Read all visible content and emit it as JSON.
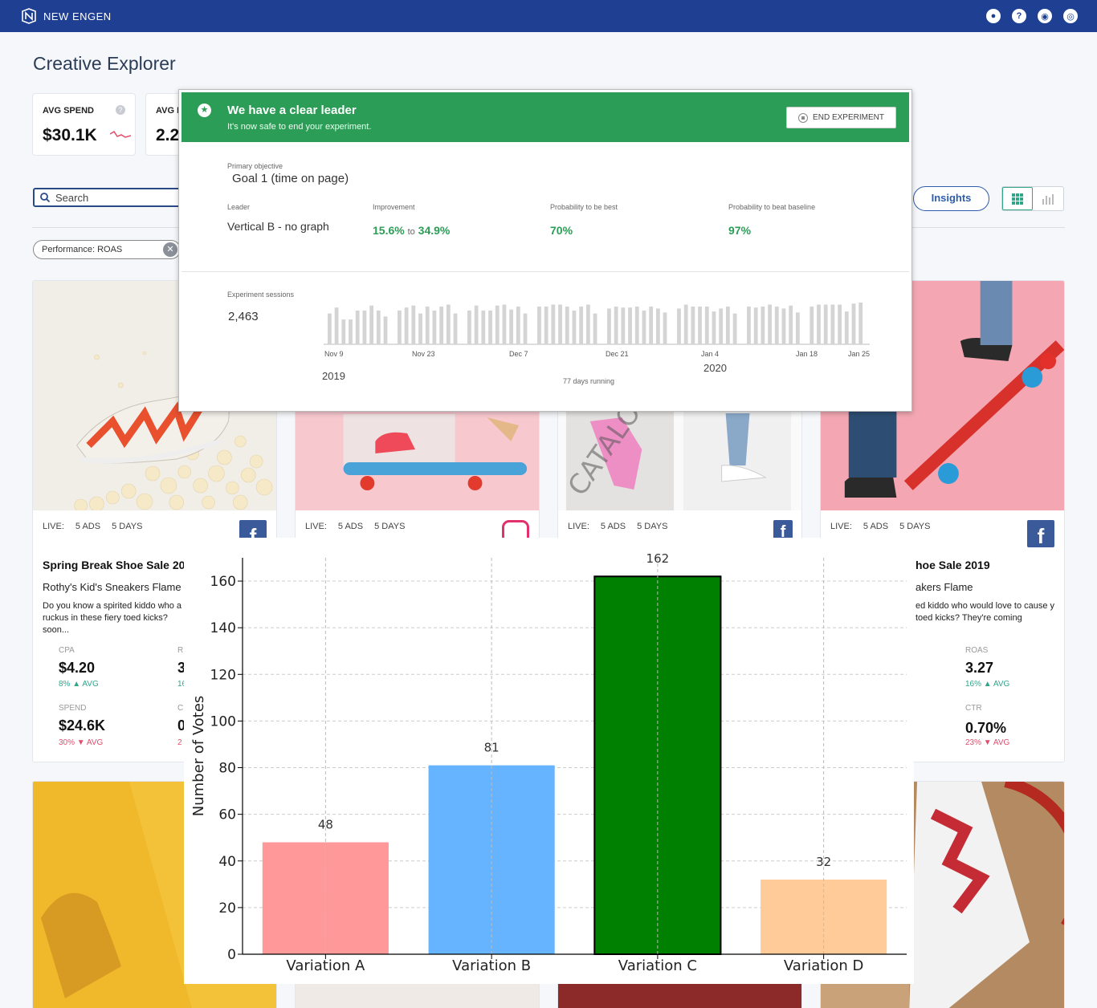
{
  "app": {
    "brand": "NEW ENGEN",
    "page_title": "Creative Explorer"
  },
  "nav_icons": [
    "bell-icon",
    "help-icon",
    "target-icon",
    "account-icon"
  ],
  "kpis": [
    {
      "label": "AVG SPEND",
      "value": "$30.1K"
    },
    {
      "label": "AVG R",
      "value": "2.2"
    }
  ],
  "toolbar": {
    "search_label": "Search",
    "filter_chip": "Performance: ROAS",
    "insights_label": "Insights"
  },
  "cards": [
    {
      "live": "LIVE:",
      "ads": "5 ADS",
      "days": "5 DAYS",
      "title": "Spring Break Shoe Sale 20",
      "subtitle": "Rothy's Kid's Sneakers Flame",
      "desc": "Do you know a spirited kiddo who a ruckus in these fiery toed kicks? soon...",
      "m1_label": "CPA",
      "m1_value": "$4.20",
      "m1_change": "8%",
      "m1_avg": "AVG",
      "m2_label": "SPEND",
      "m2_value": "$24.6K",
      "m2_change": "30%",
      "m2_avg": "AVG",
      "m3_label": "R",
      "m3_value": "3",
      "m3_change": "16",
      "m4_label": "C",
      "m4_value": "0",
      "m4_change": "2"
    },
    {
      "live": "LIVE:",
      "ads": "5 ADS",
      "days": "5 DAYS"
    },
    {
      "live": "LIVE:",
      "ads": "5 ADS",
      "days": "5 DAYS",
      "watermark": "CATALOG"
    },
    {
      "live": "LIVE:",
      "ads": "5 ADS",
      "days": "5 DAYS",
      "title": "hoe Sale 2019",
      "subtitle": "akers Flame",
      "desc": "ed kiddo who would love to cause y toed kicks? They're coming",
      "m1_label": "ROAS",
      "m1_value": "3.27",
      "m1_change": "16%",
      "m1_avg": "AVG",
      "m2_label": "CTR",
      "m2_value": "0.70%",
      "m2_change": "23%",
      "m2_avg": "AVG"
    }
  ],
  "experiment": {
    "header_title": "We have a clear leader",
    "header_subtitle": "It's now safe to end your experiment.",
    "end_button": "END EXPERIMENT",
    "objective_label": "Primary objective",
    "objective_value": "Goal 1 (time on page)",
    "leader_label": "Leader",
    "leader_value": "Vertical B - no graph",
    "improvement_label": "Improvement",
    "improvement_low": "15.6%",
    "improvement_to": "to",
    "improvement_high": "34.9%",
    "prob_best_label": "Probability to be best",
    "prob_best_value": "70%",
    "prob_baseline_label": "Probability to beat baseline",
    "prob_baseline_value": "97%",
    "sessions_label": "Experiment sessions",
    "sessions_value": "2,463",
    "date_ticks": [
      "Nov 9",
      "Nov 23",
      "Dec 7",
      "Dec 21",
      "Jan 4",
      "Jan 18",
      "Jan 25"
    ],
    "year_left": "2019",
    "year_right": "2020",
    "running": "77 days running",
    "daily_sessions": [
      31,
      37,
      25,
      25,
      34,
      34,
      39,
      34,
      28,
      0,
      34,
      37,
      39,
      31,
      38,
      34,
      38,
      40,
      31,
      0,
      34,
      39,
      34,
      34,
      39,
      40,
      35,
      38,
      31,
      0,
      38,
      38,
      40,
      40,
      38,
      34,
      38,
      40,
      31,
      0,
      36,
      38,
      37,
      37,
      38,
      34,
      38,
      36,
      32,
      0,
      36,
      40,
      38,
      38,
      38,
      33,
      36,
      38,
      31,
      0,
      38,
      37,
      38,
      40,
      38,
      36,
      39,
      32,
      0,
      38,
      40,
      40,
      40,
      40,
      33,
      41,
      42
    ]
  },
  "chart_data": {
    "type": "bar",
    "categories": [
      "Variation A",
      "Variation B",
      "Variation C",
      "Variation D"
    ],
    "values": [
      48,
      81,
      162,
      32
    ],
    "colors": [
      "#ff9999",
      "#66b3ff",
      "#008000",
      "#ffcc99"
    ],
    "highlight": "Variation C",
    "ylabel": "Number of Votes",
    "xlabel": "",
    "ylim": [
      0,
      170
    ],
    "yticks": [
      0,
      20,
      40,
      60,
      80,
      100,
      120,
      140,
      160
    ],
    "grid": true
  }
}
